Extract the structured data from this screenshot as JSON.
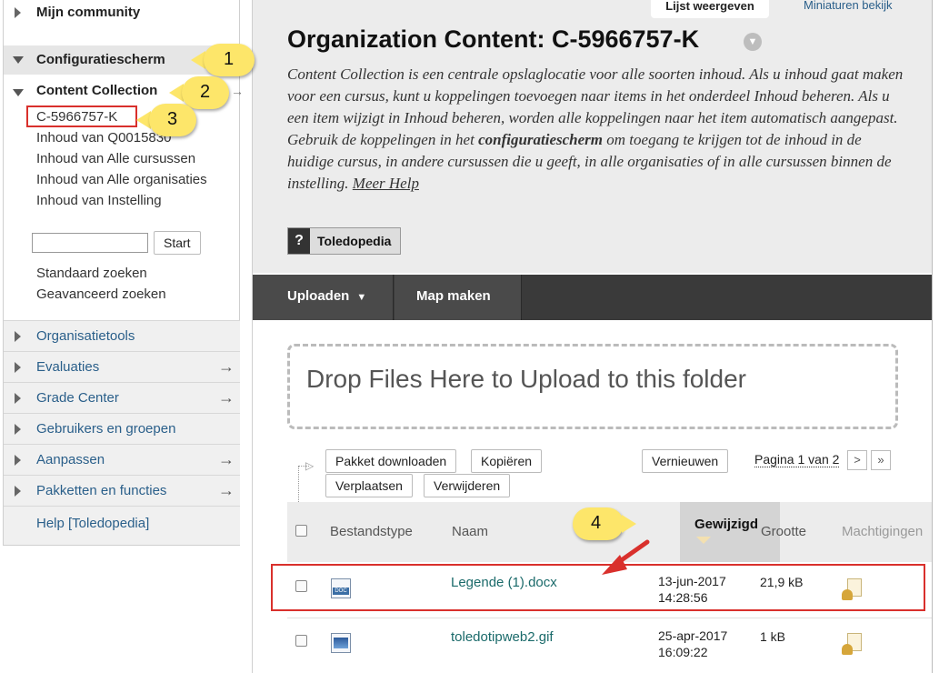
{
  "sidebar": {
    "community": "Mijn community",
    "config": "Configuratiescherm",
    "content_collection": "Content Collection",
    "cc_items": [
      "C-5966757-K",
      "Inhoud van Q0015830",
      "Inhoud van Alle cursussen",
      "Inhoud van Alle organisaties",
      "Inhoud van Instelling"
    ],
    "search_placeholder": "",
    "search_button": "Start",
    "search_links": [
      "Standaard zoeken",
      "Geavanceerd zoeken"
    ],
    "sections": [
      {
        "label": "Organisatietools",
        "arrow": ""
      },
      {
        "label": "Evaluaties",
        "arrow": "→"
      },
      {
        "label": "Grade Center",
        "arrow": "→"
      },
      {
        "label": "Gebruikers en groepen",
        "arrow": ""
      },
      {
        "label": "Aanpassen",
        "arrow": "→"
      },
      {
        "label": "Pakketten en functies",
        "arrow": "→"
      }
    ],
    "help": "Help [Toledopedia]"
  },
  "main": {
    "top_tab": "Lijst weergeven",
    "top_link": "Miniaturen bekijk",
    "title": "Organization Content: C-5966757-K",
    "description_1": "Content Collection is een centrale opslaglocatie voor alle soorten inhoud. Als u inhoud gaat maken voor een cursus, kunt u koppelingen toevoegen naar items in het onderdeel Inhoud beheren. Als u een item wijzigt in Inhoud beheren, worden alle koppelingen naar het item automatisch aangepast. Gebruik de koppelingen in het ",
    "description_bold": "configuratiescherm",
    "description_2": " om toegang te krijgen tot de inhoud in de huidige cursus, in andere cursussen die u geeft, in alle organisaties of in alle cursussen binnen de instelling. ",
    "more_help": "Meer Help",
    "help_button_icon": "?",
    "help_button": "Toledopedia",
    "toolbar": {
      "upload": "Uploaden",
      "new_folder": "Map maken"
    },
    "dropzone": "Drop Files Here to Upload to this folder",
    "actions": {
      "download": "Pakket downloaden",
      "copy": "Kopiëren",
      "move": "Verplaatsen",
      "delete": "Verwijderen",
      "refresh": "Vernieuwen"
    },
    "pager": {
      "text": "Pagina 1 van 2",
      "next": ">",
      "last": "»"
    },
    "columns": {
      "type": "Bestandstype",
      "name": "Naam",
      "modified": "Gewijzigd",
      "size": "Grootte",
      "perm": "Machtigingen"
    },
    "rows": [
      {
        "name": "Legende (1).docx",
        "date": "13-jun-2017",
        "time": "14:28:56",
        "size": "21,9 kB",
        "icon": "docx-icon"
      },
      {
        "name": "toledotipweb2.gif",
        "date": "25-apr-2017",
        "time": "16:09:22",
        "size": "1 kB",
        "icon": "image-icon"
      }
    ]
  },
  "annotations": {
    "c1": "1",
    "c2": "2",
    "c3": "3",
    "c4": "4",
    "highlight_color": "#d9302c",
    "callout_color": "#fde66a"
  }
}
